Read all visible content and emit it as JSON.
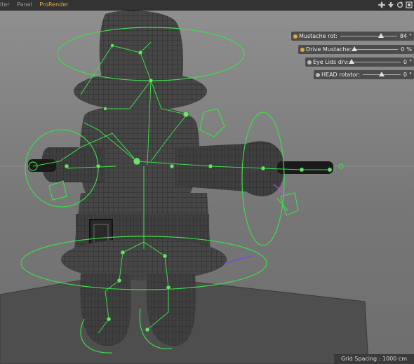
{
  "menubar": {
    "items": [
      {
        "label": "lter"
      },
      {
        "label": "Panel"
      },
      {
        "label": "ProRender"
      }
    ],
    "icons": [
      "move-view-icon",
      "down-arrow-icon",
      "rotate-view-icon",
      "maximize-icon"
    ]
  },
  "hud": {
    "controls": [
      {
        "label": "Mustache rot:",
        "value": "84",
        "unit": "°",
        "level": 0.72,
        "dot_color": "#e8a33d"
      },
      {
        "label": "Drive Mustache:",
        "value": "0",
        "unit": "%",
        "level": 0.0,
        "dot_color": "#e8a33d"
      },
      {
        "label": "Eye Lids drv:",
        "value": "0",
        "unit": "°",
        "level": 0.0,
        "dot_color": "#bbbbbb"
      },
      {
        "label": "HEAD rotator:",
        "value": "0",
        "unit": "°",
        "level": 0.5,
        "dot_color": "#bbbbbb"
      }
    ]
  },
  "status": {
    "grid_spacing": "Grid Spacing : 1000 cm"
  },
  "colors": {
    "rig": "#3ddc4a",
    "mesh": "#3a3a3a",
    "wire": "#1c1c1c",
    "accent": "#e8a33d"
  }
}
